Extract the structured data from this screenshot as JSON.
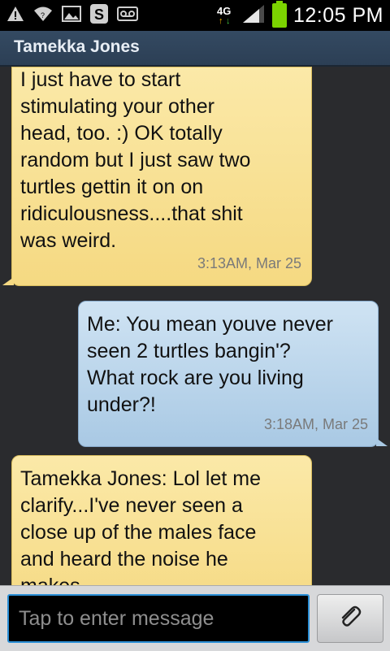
{
  "status_bar": {
    "time": "12:05 PM",
    "network": "4G",
    "icons": [
      "warning-icon",
      "wifi-icon",
      "image-icon",
      "app-s-icon",
      "voicemail-icon",
      "network-4g-icon",
      "signal-icon",
      "battery-icon"
    ]
  },
  "header": {
    "title": "Tamekka Jones"
  },
  "messages": [
    {
      "direction": "incoming",
      "lines": [
        "I just have to start",
        "stimulating your other",
        "head, too.  :) OK totally",
        "random but I just saw two",
        "turtles gettin it on on",
        "ridiculousness....that shit",
        "was weird."
      ],
      "time": "3:13AM, Mar 25"
    },
    {
      "direction": "outgoing",
      "lines": [
        "Me: You mean youve never",
        "seen 2 turtles bangin'?",
        "What rock are you living",
        "under?!"
      ],
      "time": "3:18AM, Mar 25"
    },
    {
      "direction": "incoming",
      "lines": [
        "Tamekka Jones: Lol let me",
        "clarify...I've never seen a",
        "close up of the males face",
        "and heard the noise he",
        "makes..."
      ]
    }
  ],
  "compose": {
    "placeholder": "Tap to enter message",
    "attach_icon": "paperclip-icon"
  },
  "colors": {
    "incoming_bubble": "#f5d982",
    "outgoing_bubble": "#a9c9e4",
    "titlebar": "#2c3f55",
    "input_border": "#2b8fd6",
    "battery": "#7bd300"
  }
}
